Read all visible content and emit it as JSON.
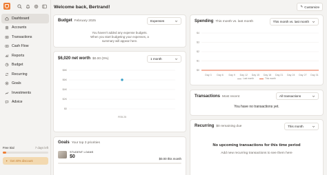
{
  "sidebar": {
    "items": [
      {
        "label": "Dashboard",
        "icon": "home-icon",
        "active": true
      },
      {
        "label": "Accounts",
        "icon": "accounts-icon"
      },
      {
        "label": "Transactions",
        "icon": "transactions-icon"
      },
      {
        "label": "Cash Flow",
        "icon": "cash-flow-icon"
      },
      {
        "label": "Reports",
        "icon": "reports-icon"
      },
      {
        "label": "Budget",
        "icon": "budget-icon"
      },
      {
        "label": "Recurring",
        "icon": "recurring-icon"
      },
      {
        "label": "Goals",
        "icon": "goals-icon"
      },
      {
        "label": "Investments",
        "icon": "investments-icon"
      },
      {
        "label": "Advice",
        "icon": "advice-icon"
      }
    ],
    "trial": {
      "label": "Free trial",
      "remaining": "7 days left",
      "progress": 0.08,
      "promo": "Get 40% discount"
    }
  },
  "header": {
    "welcome": "Welcome back, Bertrand!",
    "customize_label": "Customize"
  },
  "budget": {
    "title": "Budget",
    "period": "February 2025",
    "select": "Expenses",
    "empty_lines": [
      "You haven't added any expense budgets.",
      "When you start budgeting your expenses, a",
      "summary will appear here."
    ]
  },
  "networth": {
    "title": "$6,020 net worth",
    "change": "$0.00 (0%)",
    "select": "1 month",
    "chart_data": {
      "type": "scatter",
      "y_ticks": [
        "$8K",
        "$6K",
        "$4K",
        "$2K",
        "$0"
      ],
      "x_labels": [
        "FEB 25"
      ],
      "points": [
        {
          "x": "FEB 25",
          "y": 6020
        }
      ],
      "ylim": [
        0,
        8000
      ],
      "grid": true
    }
  },
  "goals": {
    "title": "Goals",
    "subtitle": "Your top 3 priorities",
    "items": [
      {
        "name": "STUDENT LOANS",
        "amount": "$0",
        "progress_text": "$0.00 this month",
        "progress": 0
      }
    ]
  },
  "spending": {
    "title": "Spending",
    "subtitle": "This month vs. last month",
    "select": "This month vs. last month",
    "chart_data": {
      "type": "line",
      "y_ticks": [
        "$4",
        "$3",
        "$2",
        "$1",
        "$0"
      ],
      "x_labels": [
        "Day 3",
        "Day 6",
        "Day 9",
        "Day 12",
        "Day 15",
        "Day 18",
        "Day 21",
        "Day 24",
        "Day 27",
        "Day 31"
      ],
      "ylim": [
        0,
        4
      ],
      "series": [
        {
          "name": "Last month",
          "values": [
            0,
            0,
            0,
            0,
            0,
            0,
            0,
            0,
            0,
            0
          ],
          "color": "#b0aaa4"
        },
        {
          "name": "This month",
          "values": [
            0,
            0,
            0,
            0,
            0,
            0,
            0,
            0,
            0,
            0
          ],
          "color": "#e8643c"
        }
      ],
      "grid": true
    }
  },
  "transactions": {
    "title": "Transactions",
    "subtitle": "Most recent",
    "select": "All transactions",
    "empty": "You have no transactions yet."
  },
  "recurring": {
    "title": "Recurring",
    "subtitle": "$0 remaining due",
    "select": "This month",
    "empty_title": "No upcoming transactions for this time period",
    "empty_sub": "Add new recurring transactions to see them here"
  },
  "colors": {
    "accent": "#ee7e35",
    "this_month": "#e8643c",
    "last_month": "#b0aaa4",
    "point": "#3aa0c8"
  }
}
